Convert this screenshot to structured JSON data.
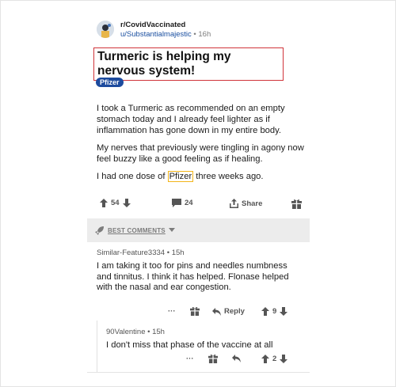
{
  "post": {
    "subreddit": "r/CovidVaccinated",
    "author": "u/Substantialmajestic",
    "separator": "•",
    "time": "16h",
    "title": "Turmeric is helping my nervous system!",
    "flair": "Pfizer",
    "paragraphs": [
      "I took a Turmeric as recommended on an empty stomach today and I already feel lighter as if inflammation has gone down in my entire body.",
      "My nerves that previously were tingling in agony now feel buzzy like a good feeling as if healing."
    ],
    "para3_before": "I had one dose of ",
    "para3_highlight": "Pfizer",
    "para3_after": " three weeks ago.",
    "votes": "54",
    "comments": "24",
    "share_label": "Share"
  },
  "comments_bar": {
    "label": "BEST COMMENTS"
  },
  "comment1": {
    "author": "Similar-Feature3334",
    "separator": "•",
    "time": "15h",
    "text": "I am taking it too for pins and needles numbness and tinnitus. I think it has helped. Flonase helped with the nasal and ear congestion.",
    "more": "···",
    "reply_label": "Reply",
    "votes": "9"
  },
  "comment2": {
    "author": "90Valentine",
    "separator": "•",
    "time": "15h",
    "text": "I don't miss that phase of the vaccine at all",
    "more": "···",
    "votes": "2"
  },
  "colors": {
    "accent_blue": "#1d4b9e",
    "title_box_red": "#d0343a",
    "highlight_yellow": "#f2b51a",
    "bar_gray": "#ececec"
  }
}
